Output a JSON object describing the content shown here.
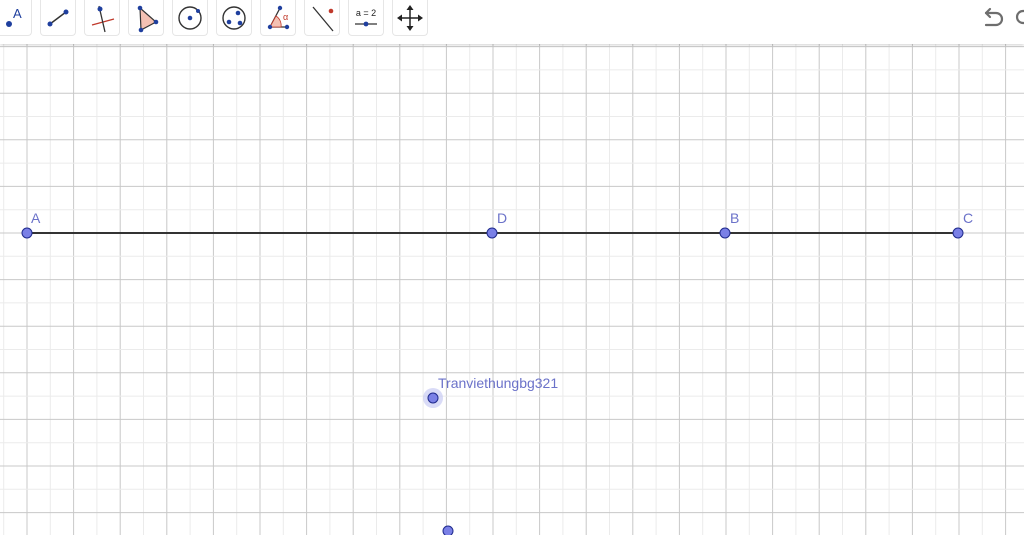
{
  "app": {
    "accent_color": "#5b62d6",
    "point_fill": "#7a80e6",
    "segment_color": "#333333",
    "grid_minor": "#ebebeb",
    "grid_major": "#c8c8c8"
  },
  "toolbar": {
    "tools": [
      {
        "name": "tool-point",
        "icon": "point-icon",
        "glyph": "A"
      },
      {
        "name": "tool-segment",
        "icon": "segment-icon"
      },
      {
        "name": "tool-perpendicular-line",
        "icon": "perpendicular-line-icon"
      },
      {
        "name": "tool-polygon",
        "icon": "polygon-icon"
      },
      {
        "name": "tool-circle-center-point",
        "icon": "circle-center-point-icon"
      },
      {
        "name": "tool-circle-three-points",
        "icon": "circle-three-points-icon"
      },
      {
        "name": "tool-angle",
        "icon": "angle-icon",
        "glyph": "α"
      },
      {
        "name": "tool-reflect",
        "icon": "reflect-icon"
      },
      {
        "name": "tool-slider",
        "icon": "slider-icon",
        "glyph": "a = 2"
      },
      {
        "name": "tool-move-graphics-view",
        "icon": "move-icon"
      }
    ],
    "undo_icon": "undo-icon",
    "redo_icon": "redo-icon"
  },
  "canvas": {
    "points": [
      {
        "name": "point-a",
        "label": "A"
      },
      {
        "name": "point-d",
        "label": "D"
      },
      {
        "name": "point-b",
        "label": "B"
      },
      {
        "name": "point-c",
        "label": "C"
      },
      {
        "name": "point-tranviethungbg321",
        "label": "Tranviethungbg321"
      },
      {
        "name": "point-unlabeled",
        "label": ""
      }
    ],
    "segment": "A-C"
  }
}
